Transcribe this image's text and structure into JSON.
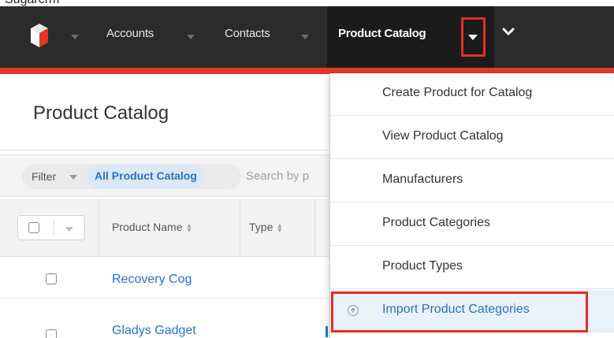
{
  "window": {
    "cut_text": "Sugarcrm"
  },
  "navbar": {
    "items": [
      {
        "label": "Accounts"
      },
      {
        "label": "Contacts"
      }
    ],
    "active_item": {
      "label": "Product Catalog"
    }
  },
  "page": {
    "title": "Product Catalog"
  },
  "filter": {
    "label": "Filter",
    "chip": "All Product Catalog",
    "search_placeholder": "Search by p"
  },
  "table": {
    "columns": [
      {
        "label": "Product Name"
      },
      {
        "label": "Type"
      }
    ],
    "rows": [
      {
        "name": "Recovery Cog"
      },
      {
        "name": "Gladys Gadget"
      }
    ]
  },
  "dropdown": {
    "items": [
      {
        "label": "Create Product for Catalog"
      },
      {
        "label": "View Product Catalog"
      },
      {
        "label": "Manufacturers"
      },
      {
        "label": "Product Categories"
      },
      {
        "label": "Product Types"
      },
      {
        "label": "Import Product Categories",
        "active": true
      }
    ]
  },
  "colors": {
    "navbar_bg": "#2b2b2b",
    "accent_red": "#e23626",
    "link_blue": "#2a72c3",
    "highlight_red": "#e1301f"
  },
  "icons": [
    "sugar-logo-icon",
    "caret-down-icon",
    "chevron-down-icon",
    "sort-icon",
    "checkbox-icon",
    "import-icon"
  ]
}
